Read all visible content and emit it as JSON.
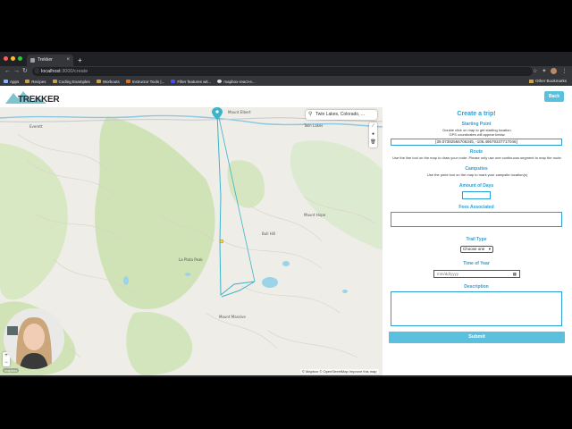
{
  "browser": {
    "tab_title": "Trekker",
    "url_host": "localhost",
    "url_path": ":3000/create",
    "bookmarks": [
      "Apps",
      "Recipes",
      "Coding Examples",
      "Workouts",
      "Instructor Tools |...",
      "Filter features wit...",
      "mapbox-react-e..."
    ],
    "other_bookmarks": "Other Bookmarks"
  },
  "app": {
    "logo_text": "TREKKER",
    "back_label": "Back"
  },
  "map": {
    "search_value": "Twin Lakes, Colorado, ...",
    "attribution": "© Mapbox © OpenStreetMap  Improve this map",
    "logo": "mapbox",
    "labels": {
      "everett": "Everett",
      "twin_lakes": "Twin Lakes",
      "mount_elbert": "Mount Elbert",
      "la_plata_peak": "La Plata Peak",
      "mount_hope": "Mount Hope",
      "bull_hill": "Bull Hill",
      "mount_massive": "Mount Massive"
    },
    "route_color": "#3bb4c8"
  },
  "form": {
    "title": "Create a trip!",
    "starting_point_label": "Starting Point",
    "starting_point_help": "Double click on map to get starting location.",
    "gps_help": "GPS coordinates will appear below.",
    "coordinates": "[39.07392566706345, -106.48679337717046]",
    "route_label": "Route",
    "route_help": "Use the line tool on the map to draw your route. Please only use one continuous segment to map the route.",
    "campsites_label": "Campsites",
    "campsites_help": "Use the point tool on the map to mark your campsite location(s)",
    "days_label": "Amount of Days",
    "fees_label": "Fees Associated",
    "trail_type_label": "Trail Type",
    "trail_type_value": "Choose one",
    "time_label": "Time of Year",
    "date_placeholder": "mm/dd/yyyy",
    "description_label": "Description",
    "submit_label": "Submit"
  },
  "colors": {
    "accent": "#2a9fd6",
    "button": "#5bc0de"
  }
}
